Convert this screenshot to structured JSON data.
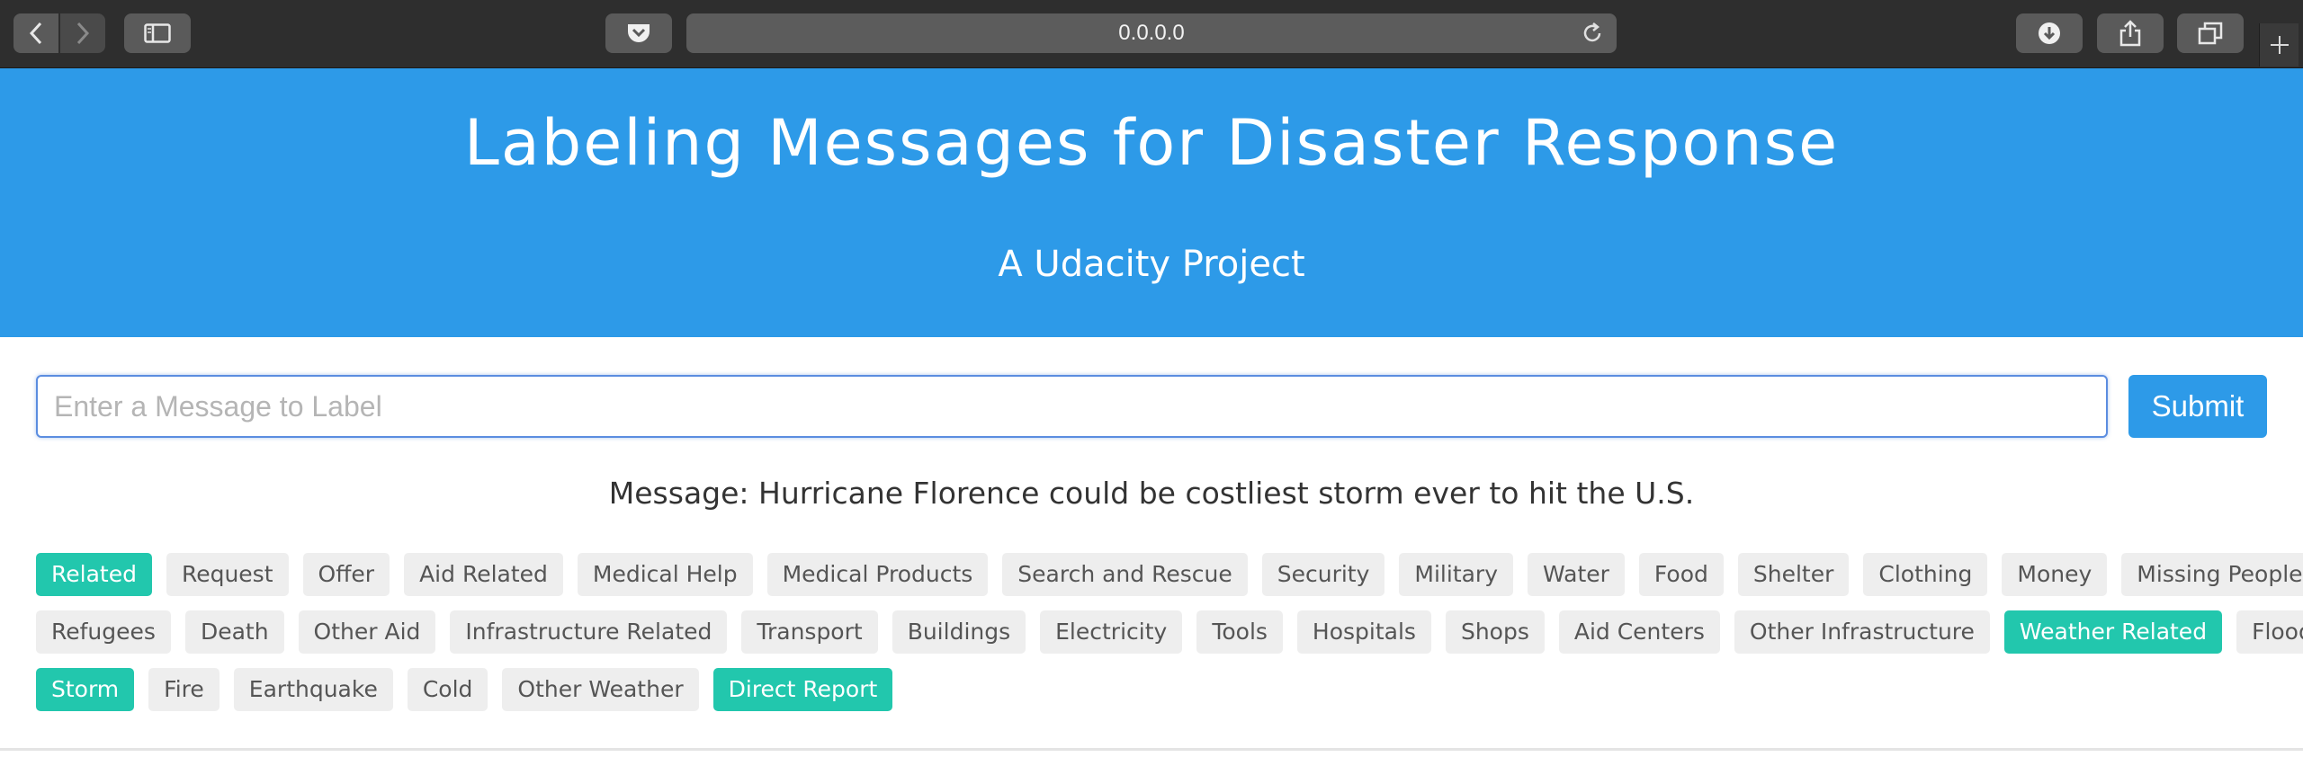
{
  "browser": {
    "url": "0.0.0.0",
    "icons": {
      "back": "chevron-left-icon",
      "forward": "chevron-right-icon",
      "sidebar": "sidebar-icon",
      "pocket": "pocket-icon",
      "reload": "reload-icon",
      "downloads": "download-icon",
      "share": "share-icon",
      "tabs": "tabs-icon",
      "new_tab": "plus-icon"
    }
  },
  "hero": {
    "title": "Labeling Messages for Disaster Response",
    "subtitle": "A Udacity Project"
  },
  "form": {
    "placeholder": "Enter a Message to Label",
    "value": "",
    "submit_label": "Submit"
  },
  "result": {
    "message_text": "Message: Hurricane Florence could be costliest storm ever to hit the U.S."
  },
  "labels": {
    "rows": [
      [
        {
          "label": "Related",
          "active": true
        },
        {
          "label": "Request",
          "active": false
        },
        {
          "label": "Offer",
          "active": false
        },
        {
          "label": "Aid Related",
          "active": false
        },
        {
          "label": "Medical Help",
          "active": false
        },
        {
          "label": "Medical Products",
          "active": false
        },
        {
          "label": "Search and Rescue",
          "active": false
        },
        {
          "label": "Security",
          "active": false
        },
        {
          "label": "Military",
          "active": false
        },
        {
          "label": "Water",
          "active": false
        },
        {
          "label": "Food",
          "active": false
        },
        {
          "label": "Shelter",
          "active": false
        },
        {
          "label": "Clothing",
          "active": false
        },
        {
          "label": "Money",
          "active": false
        },
        {
          "label": "Missing People",
          "active": false
        }
      ],
      [
        {
          "label": "Refugees",
          "active": false
        },
        {
          "label": "Death",
          "active": false
        },
        {
          "label": "Other Aid",
          "active": false
        },
        {
          "label": "Infrastructure Related",
          "active": false
        },
        {
          "label": "Transport",
          "active": false
        },
        {
          "label": "Buildings",
          "active": false
        },
        {
          "label": "Electricity",
          "active": false
        },
        {
          "label": "Tools",
          "active": false
        },
        {
          "label": "Hospitals",
          "active": false
        },
        {
          "label": "Shops",
          "active": false
        },
        {
          "label": "Aid Centers",
          "active": false
        },
        {
          "label": "Other Infrastructure",
          "active": false
        },
        {
          "label": "Weather Related",
          "active": true
        },
        {
          "label": "Floods",
          "active": false
        }
      ],
      [
        {
          "label": "Storm",
          "active": true
        },
        {
          "label": "Fire",
          "active": false
        },
        {
          "label": "Earthquake",
          "active": false
        },
        {
          "label": "Cold",
          "active": false
        },
        {
          "label": "Other Weather",
          "active": false
        },
        {
          "label": "Direct Report",
          "active": true
        }
      ]
    ]
  },
  "colors": {
    "primary": "#2d9ae8",
    "label_active": "#22c7ad",
    "label_inactive": "#eeeeee",
    "toolbar": "#2e2e2e"
  }
}
